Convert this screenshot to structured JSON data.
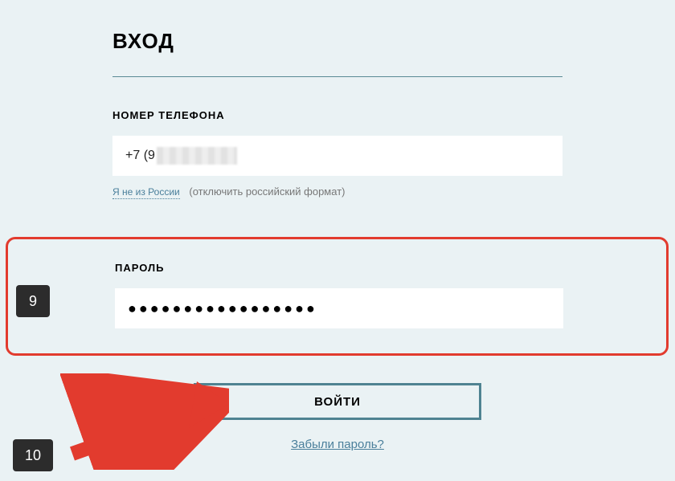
{
  "title": "ВХОД",
  "phone": {
    "label": "НОМЕР ТЕЛЕФОНА",
    "prefix": "+7 (9",
    "hint_link": "Я не из России",
    "hint_text": "(отключить российский формат)"
  },
  "password": {
    "label": "ПАРОЛЬ",
    "masked": "●●●●●●●●●●●●●●●●●"
  },
  "submit_label": "ВОЙТИ",
  "forgot_label": "Забыли пароль?",
  "annotations": {
    "badge9": "9",
    "badge10": "10"
  }
}
